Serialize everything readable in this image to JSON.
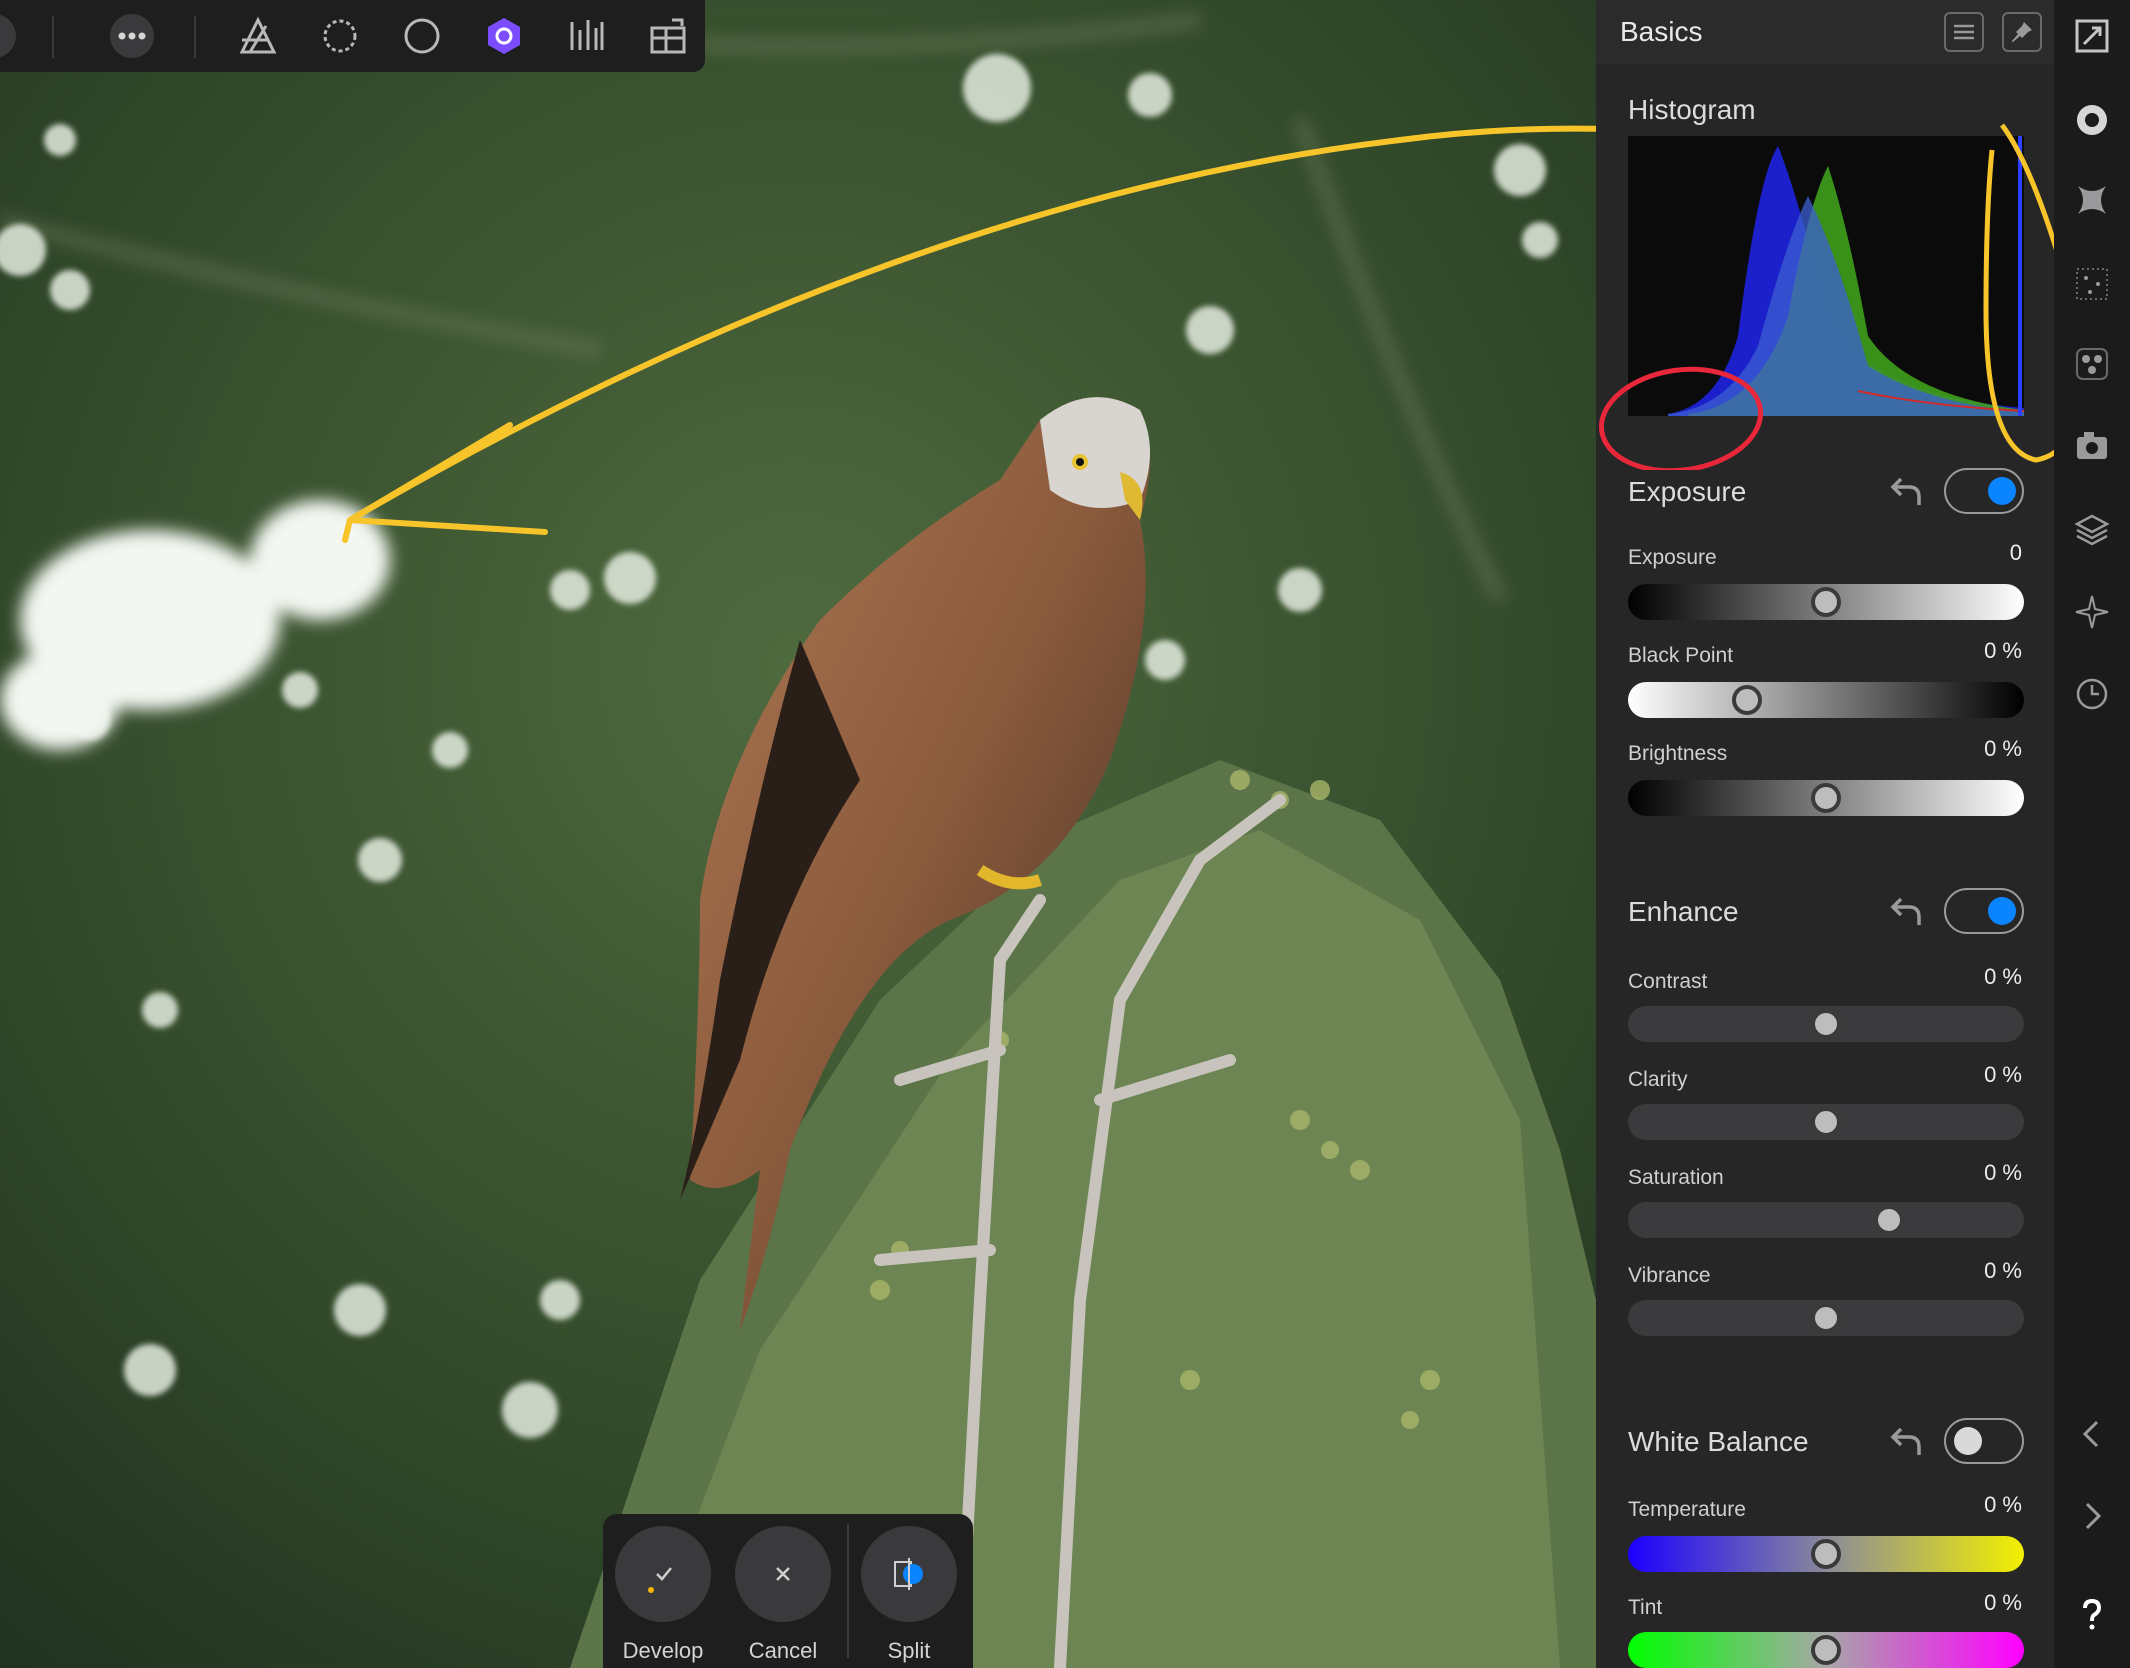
{
  "panel": {
    "title": "Basics",
    "histogram_label": "Histogram",
    "sections": {
      "exposure": {
        "label": "Exposure",
        "enabled": true,
        "params": [
          {
            "label": "Exposure",
            "value": "0",
            "level": 0.5
          },
          {
            "label": "Black Point",
            "value": "0 %",
            "level": 0.3
          },
          {
            "label": "Brightness",
            "value": "0 %",
            "level": 0.5
          }
        ]
      },
      "enhance": {
        "label": "Enhance",
        "enabled": true,
        "params": [
          {
            "label": "Contrast",
            "value": "0 %",
            "level": 0.5
          },
          {
            "label": "Clarity",
            "value": "0 %",
            "level": 0.5
          },
          {
            "label": "Saturation",
            "value": "0 %",
            "level": 0.66
          },
          {
            "label": "Vibrance",
            "value": "0 %",
            "level": 0.5
          }
        ]
      },
      "white_balance": {
        "label": "White Balance",
        "enabled": false,
        "params": [
          {
            "label": "Temperature",
            "value": "0 %",
            "level": 0.5
          },
          {
            "label": "Tint",
            "value": "0 %",
            "level": 0.5
          }
        ]
      }
    }
  },
  "bottom_bar": {
    "develop": "Develop",
    "cancel": "Cancel",
    "split": "Split"
  },
  "colors": {
    "accent": "#0a84ff",
    "active_persona": "#7b4dff",
    "annotation_yellow": "#f7c52a",
    "annotation_red": "#e8283a"
  }
}
